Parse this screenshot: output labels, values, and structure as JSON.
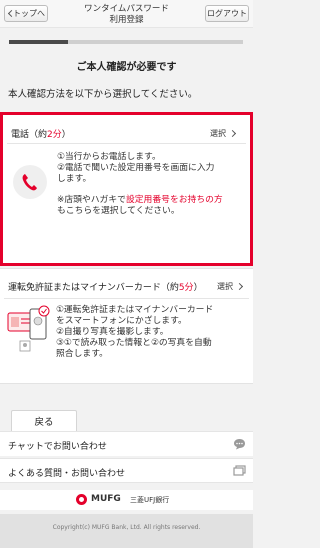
{
  "header": {
    "back_label": "トップへ",
    "title_line1": "ワンタイムパスワード",
    "title_line2": "利用登録",
    "logout_label": "ログアウト"
  },
  "progress": {
    "fraction": 0.25
  },
  "heading": "ご本人確認が必要です",
  "subheading": "本人確認方法を以下から選択してください。",
  "phone_option": {
    "title_prefix": "電話（約",
    "title_minutes": "2分",
    "title_suffix": "）",
    "select_label": "選択",
    "line1": "①当行からお電話します。",
    "line2": "②電話で聞いた設定用番号を画面に入力",
    "line3": "します。",
    "note_prefix": "※店頭やハガキで",
    "note_red": "設定用番号をお持ちの方",
    "note_line2": "もこちらを選択してください。"
  },
  "license_option": {
    "title_prefix": "運転免許証またはマイナンバーカード（約",
    "title_minutes": "5分",
    "title_suffix": "）",
    "select_label": "選択",
    "line1": "①運転免許証またはマイナンバーカード",
    "line2": "をスマートフォンにかざします。",
    "line3": "②自撮り写真を撮影します。",
    "line4": "③①で読み取った情報と②の写真を自動",
    "line5": "照合します。"
  },
  "back_button": "戻る",
  "links": {
    "chat": "チャットでお問い合わせ",
    "faq": "よくある質問・お問い合わせ"
  },
  "footer": {
    "mufg": "MUFG",
    "bank": "三菱UFJ銀行",
    "copyright": "Copyright(c) MUFG Bank, Ltd. All rights reserved."
  },
  "colors": {
    "accent_red": "#e4002b",
    "progress_dark": "#4a4a4a"
  },
  "icons": [
    "phone-icon",
    "id-card-phone-icon",
    "chat-bubble-icon",
    "external-window-icon",
    "chevron-right-icon"
  ]
}
